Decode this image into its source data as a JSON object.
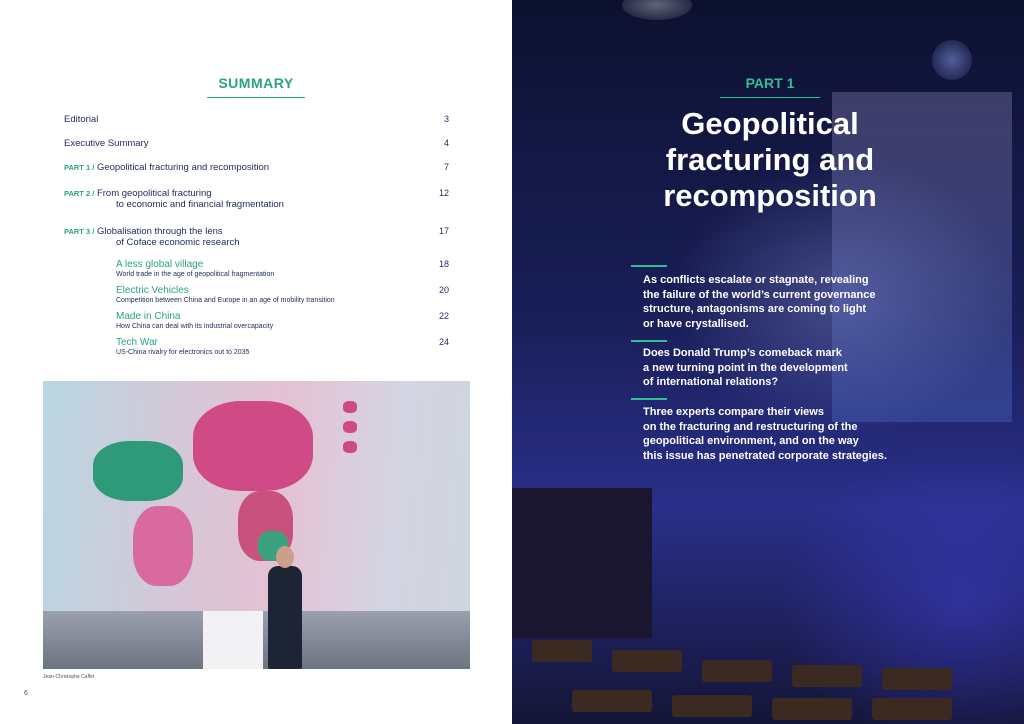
{
  "left_page": {
    "summary_title": "SUMMARY",
    "toc": [
      {
        "prefix": "",
        "title": "Editorial",
        "page": "3"
      },
      {
        "prefix": "",
        "title": "Executive Summary",
        "page": "4"
      },
      {
        "prefix": "PART 1 /",
        "title": "Geopolitical fracturing and recomposition",
        "page": "7"
      },
      {
        "prefix": "PART 2 /",
        "title": "From geopolitical fracturing",
        "title2": "to economic and financial fragmentation",
        "page": "12"
      },
      {
        "prefix": "PART 3 /",
        "title": "Globalisation through the lens",
        "title2": "of Coface economic research",
        "page": "17"
      }
    ],
    "subsections": [
      {
        "title": "A less global village",
        "desc": "World trade in the age of geopolitical fragmentation",
        "page": "18"
      },
      {
        "title": "Electric Vehicles",
        "desc": "Competition between China and Europe in an age of mobility transition",
        "page": "20"
      },
      {
        "title": "Made in China",
        "desc": "How China can deal with its industrial overcapacity",
        "page": "22"
      },
      {
        "title": "Tech War",
        "desc": "US-China rivalry for electronics out to 2035",
        "page": "24"
      }
    ],
    "photo_caption": "Jean-Christophe Caffet",
    "page_number": "6"
  },
  "right_page": {
    "part_label": "PART 1",
    "title_lines": [
      "Geopolitical",
      "fracturing and",
      "recomposition"
    ],
    "paragraphs": [
      [
        "As conflicts escalate or stagnate, revealing",
        "the failure of the world’s current governance",
        "structure, antagonisms are coming to light",
        "or have crystallised."
      ],
      [
        "Does Donald Trump’s comeback mark",
        "a new turning point in the development",
        "of international relations?"
      ],
      [
        "Three experts compare their views",
        "on the fracturing and restructuring of the",
        "geopolitical environment, and on the way",
        "this issue has penetrated corporate strategies."
      ]
    ]
  },
  "colors": {
    "accent": "#2aa37f",
    "text": "#1e2a5a",
    "background_right": "#1a1f5a"
  }
}
